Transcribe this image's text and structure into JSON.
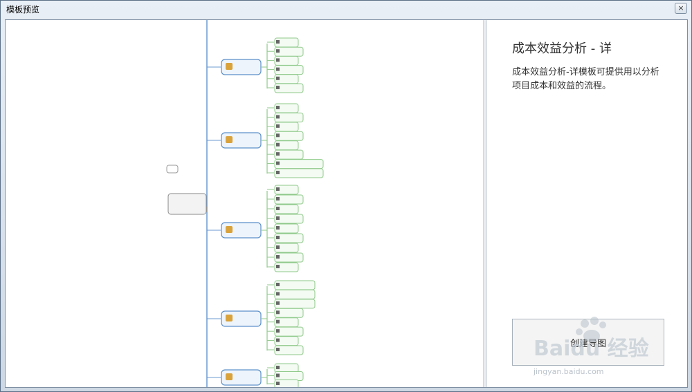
{
  "window": {
    "title": "模板预览",
    "close_label": "×"
  },
  "template": {
    "title": "成本效益分析 - 详",
    "description": "成本效益分析-详模板可提供用以分析项目成本和效益的流程。",
    "create_button": "创建导图"
  },
  "watermark": {
    "brand": "Baidu 经验",
    "url": "jingyan.baidu.com"
  },
  "colors": {
    "accent_blue": "#5b8fc9",
    "leaf_green": "#8fc98a",
    "connector": "#6b9ad1"
  }
}
